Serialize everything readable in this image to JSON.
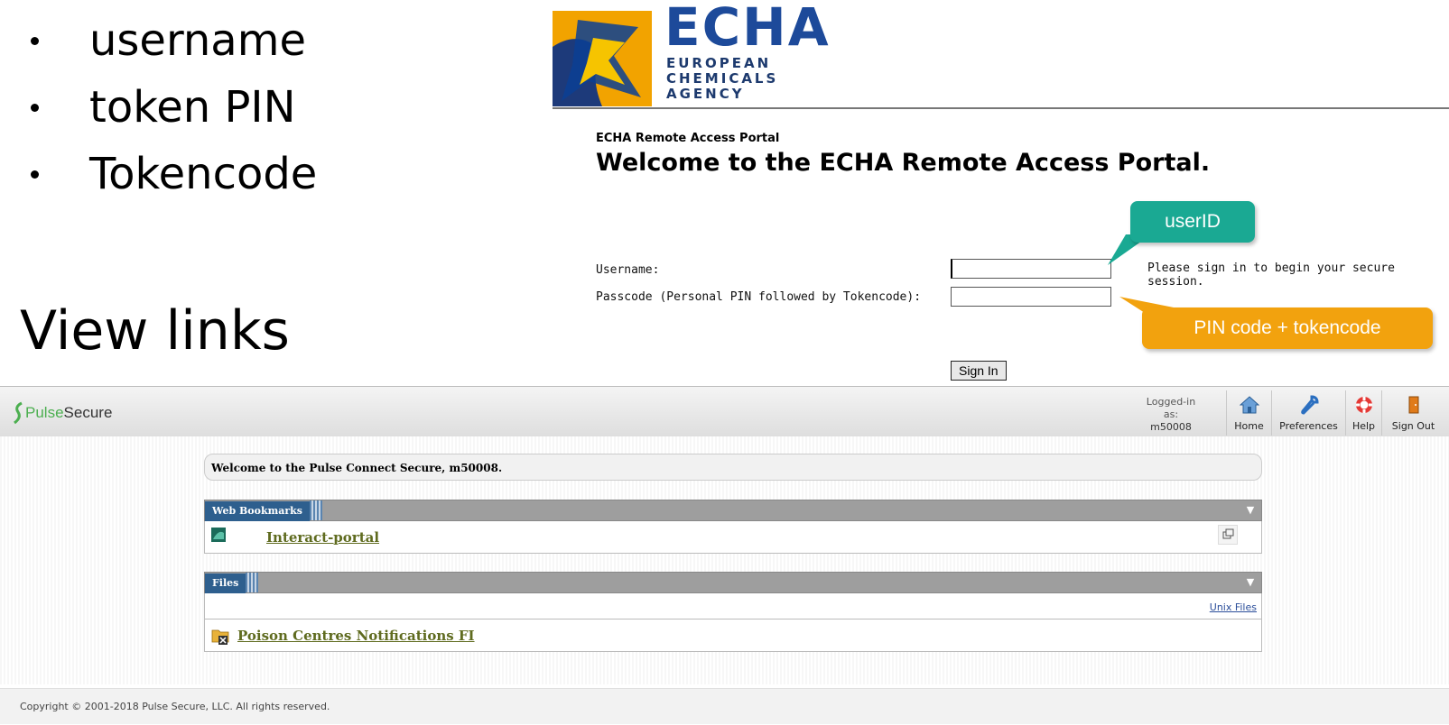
{
  "slide": {
    "bullets": [
      "username",
      "token PIN",
      "Tokencode"
    ],
    "heading": "View links"
  },
  "echa": {
    "brand": "ECHA",
    "sub_lines": [
      "EUROPEAN",
      "CHEMICALS",
      "AGENCY"
    ],
    "portal_small": "ECHA Remote Access Portal",
    "portal_title": "Welcome to the ECHA Remote Access Portal.",
    "username_label": "Username:",
    "username_value": "",
    "passcode_label": "Passcode (Personal PIN followed by Tokencode):",
    "passcode_value": "",
    "signin_message": "Please sign in to begin your secure session.",
    "signin_button": "Sign In",
    "callout_userid": "userID",
    "callout_pin": "PIN code + tokencode",
    "colors": {
      "brand": "#1d4a9a",
      "logo_bg": "#f2a300",
      "callout_userid": "#1aa993",
      "callout_pin": "#f2a20e"
    }
  },
  "pulse": {
    "logo_green": "Pulse",
    "logo_dark": "Secure",
    "logged_label": "Logged-in as:",
    "logged_user": "m50008",
    "nav": [
      {
        "label": "Home",
        "icon": "home-icon"
      },
      {
        "label": "Preferences",
        "icon": "wrench-icon"
      },
      {
        "label": "Help",
        "icon": "lifebuoy-icon"
      },
      {
        "label": "Sign Out",
        "icon": "door-icon"
      }
    ],
    "welcome": "Welcome to the Pulse Connect Secure, m50008.",
    "bookmarks_title": "Web Bookmarks",
    "bookmark_link": "Interact-portal",
    "files_title": "Files",
    "unix_files": "Unix Files",
    "files_link": "Poison Centres Notifications FI",
    "footer": "Copyright © 2001-2018 Pulse Secure, LLC. All rights reserved."
  }
}
